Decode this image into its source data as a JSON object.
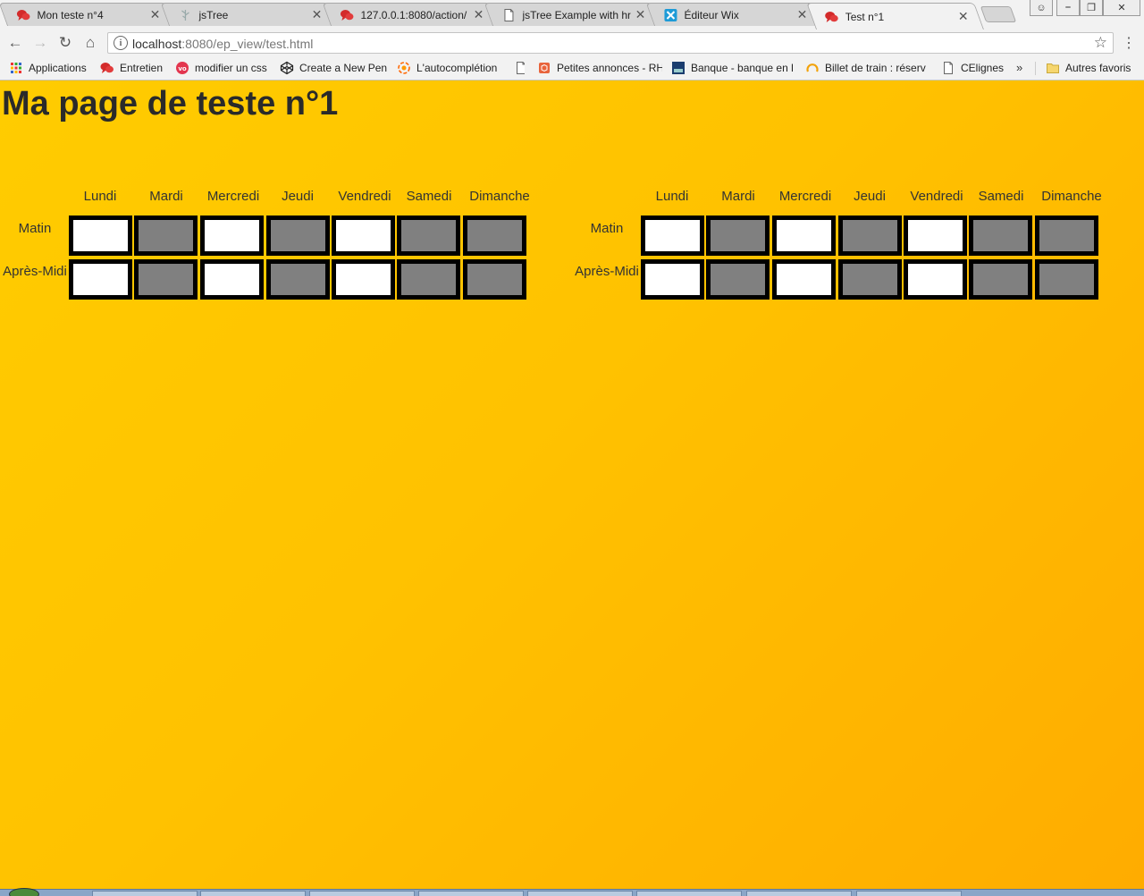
{
  "browser": {
    "tabs": [
      {
        "title": "Mon teste n°4",
        "favicon": "red-chat-icon",
        "active": false
      },
      {
        "title": "jsTree",
        "favicon": "tree-icon",
        "active": false
      },
      {
        "title": "127.0.0.1:8080/action/",
        "favicon": "red-chat-icon",
        "active": false
      },
      {
        "title": "jsTree Example with hr",
        "favicon": "page-icon",
        "active": false
      },
      {
        "title": "Éditeur Wix",
        "favicon": "wix-icon",
        "active": false
      },
      {
        "title": "Test n°1",
        "favicon": "red-chat-icon",
        "active": true
      }
    ],
    "url_host": "localhost",
    "url_path": ":8080/ep_view/test.html",
    "bookmarks": [
      {
        "label": "Applications",
        "icon": "apps-grid-icon"
      },
      {
        "label": "Entretien",
        "icon": "red-chat-icon"
      },
      {
        "label": "modifier un css",
        "icon": "vo-icon"
      },
      {
        "label": "Create a New Pen",
        "icon": "codepen-icon"
      },
      {
        "label": "L'autocomplétion",
        "icon": "flame-icon"
      },
      {
        "label": "",
        "icon": "page-icon"
      },
      {
        "label": "Petites annonces - RH",
        "icon": "cube-icon"
      },
      {
        "label": "Banque - banque en l",
        "icon": "bank-icon"
      },
      {
        "label": "Billet de train : réserv",
        "icon": "train-icon"
      },
      {
        "label": "CElignes",
        "icon": "page-icon"
      },
      {
        "label": "Autres favoris",
        "icon": "folder-icon"
      }
    ],
    "more_bookmarks": "»",
    "colors": {
      "chrome_bg": "#f2f2f2",
      "tab_inactive": "#d6d6d6",
      "page_gradient_start": "#ffcc00",
      "page_gradient_end": "#ffac00"
    }
  },
  "page": {
    "title": "Ma page de teste n°1",
    "schedules": [
      {
        "days": [
          "Lundi",
          "Mardi",
          "Mercredi",
          "Jeudi",
          "Vendredi",
          "Samedi",
          "Dimanche"
        ],
        "rows": [
          {
            "label": "Matin",
            "cells": [
              "white",
              "grey",
              "white",
              "grey",
              "white",
              "grey",
              "grey"
            ]
          },
          {
            "label": "Après-Midi",
            "cells": [
              "white",
              "grey",
              "white",
              "grey",
              "white",
              "grey",
              "grey"
            ]
          }
        ]
      },
      {
        "days": [
          "Lundi",
          "Mardi",
          "Mercredi",
          "Jeudi",
          "Vendredi",
          "Samedi",
          "Dimanche"
        ],
        "rows": [
          {
            "label": "Matin",
            "cells": [
              "white",
              "grey",
              "white",
              "grey",
              "white",
              "grey",
              "grey"
            ]
          },
          {
            "label": "Après-Midi",
            "cells": [
              "white",
              "grey",
              "white",
              "grey",
              "white",
              "grey",
              "grey"
            ]
          }
        ]
      }
    ],
    "colors": {
      "cell_on": "#ffffff",
      "cell_off": "#808080",
      "cell_border": "#000000"
    }
  }
}
